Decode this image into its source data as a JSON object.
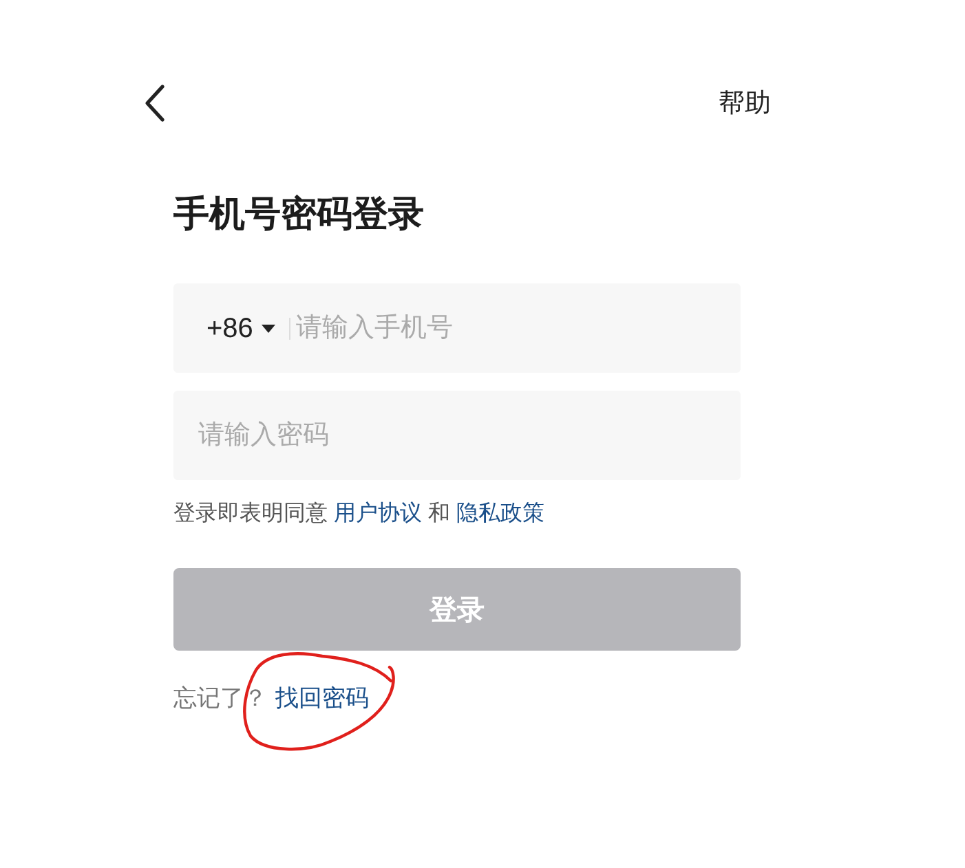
{
  "header": {
    "help": "帮助"
  },
  "title": "手机号密码登录",
  "phone_field": {
    "country_code": "+86",
    "placeholder": "请输入手机号"
  },
  "password_field": {
    "placeholder": "请输入密码"
  },
  "agreement": {
    "text": "登录即表明同意",
    "conjunction": "和",
    "links": [
      "用户协议",
      "隐私政策"
    ]
  },
  "login_button": {
    "label": "登录",
    "disabled": true
  },
  "forgot": {
    "text": "忘记了？",
    "link": "找回密码"
  },
  "annotation": {
    "kind": "circle",
    "color": "#e0201c"
  }
}
